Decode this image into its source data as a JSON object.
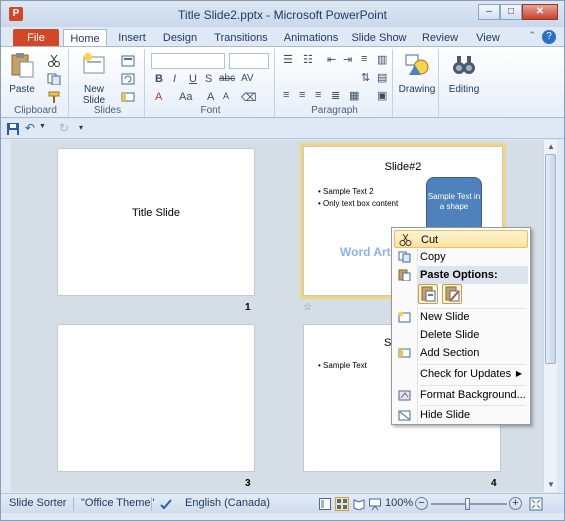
{
  "window": {
    "title": "Title Slide2.pptx - Microsoft PowerPoint",
    "app_icon_letter": "P",
    "minimize": "–",
    "maximize": "□",
    "close": "✕"
  },
  "ribbon_tabs": [
    "File",
    "Home",
    "Insert",
    "Design",
    "Transitions",
    "Animations",
    "Slide Show",
    "Review",
    "View"
  ],
  "ribbon": {
    "clipboard": {
      "label": "Clipboard",
      "paste": "Paste"
    },
    "slides": {
      "label": "Slides",
      "new_slide": "New",
      "new_slide2": "Slide"
    },
    "font": {
      "label": "Font"
    },
    "paragraph": {
      "label": "Paragraph"
    },
    "drawing": {
      "label": "Drawing"
    },
    "editing": {
      "label": "Editing"
    }
  },
  "slides": [
    {
      "number": "1",
      "title": "Title Slide"
    },
    {
      "number": "2",
      "title": "Slide#2",
      "bullets": [
        "Sample Text 2",
        "Only text box content"
      ],
      "shape_text": "Sample Text in a shape",
      "wordart": "Word Art"
    },
    {
      "number": "3"
    },
    {
      "number": "4",
      "title_partial": "Sl",
      "bullets": [
        "Sample Text"
      ]
    }
  ],
  "context_menu": {
    "cut": "Cut",
    "copy": "Copy",
    "paste_options": "Paste Options:",
    "new_slide": "New Slide",
    "delete_slide": "Delete Slide",
    "add_section": "Add Section",
    "check_updates": "Check for Updates",
    "format_background": "Format Background...",
    "hide_slide": "Hide Slide"
  },
  "statusbar": {
    "view": "Slide Sorter",
    "theme": "\"Office Theme\"",
    "language": "English (Canada)",
    "zoom": "100%"
  },
  "colors": {
    "accent": "#d24726",
    "selection": "#f2d57a",
    "shape_fill": "#4f81bd"
  }
}
